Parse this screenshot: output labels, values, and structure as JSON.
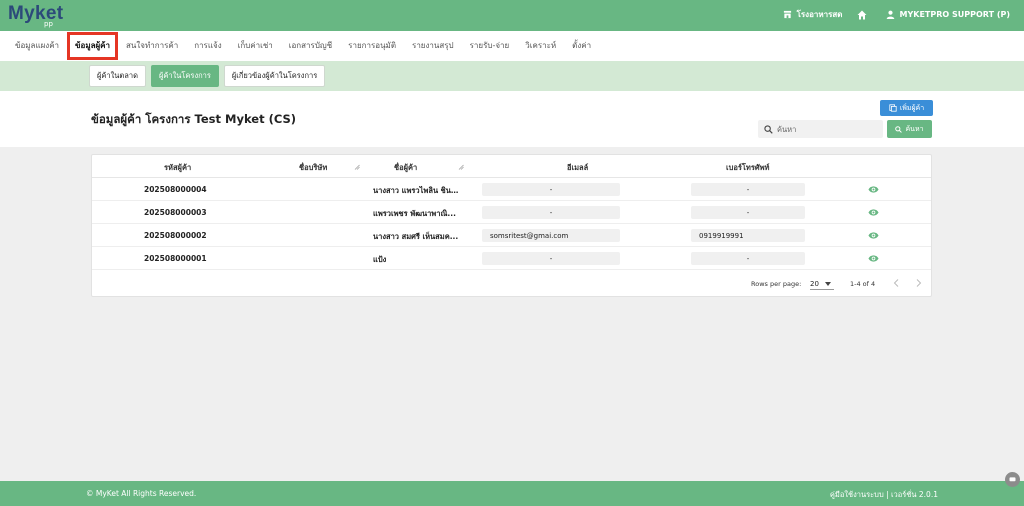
{
  "app": {
    "logo": "Myket",
    "logo_sub": "pp",
    "canteen_label": "โรงอาหารสด",
    "user_label": "MYKETPRO SUPPORT (P)"
  },
  "menu": {
    "items": [
      {
        "label": "ข้อมูลแผงค้า"
      },
      {
        "label": "ข้อมูลผู้ค้า"
      },
      {
        "label": "สนใจทำการค้า"
      },
      {
        "label": "การแจ้ง"
      },
      {
        "label": "เก็บค่าเช่า"
      },
      {
        "label": "เอกสารบัญชี"
      },
      {
        "label": "รายการอนุมัติ"
      },
      {
        "label": "รายงานสรุป"
      },
      {
        "label": "รายรับ-จ่าย"
      },
      {
        "label": "วิเคราะห์"
      },
      {
        "label": "ตั้งค่า"
      }
    ],
    "active_index": 1
  },
  "subtabs": [
    {
      "label": "ผู้ค้าในตลาด"
    },
    {
      "label": "ผู้ค้าในโครงการ"
    },
    {
      "label": "ผู้เกี่ยวข้องผู้ค้าในโครงการ"
    }
  ],
  "page": {
    "title": "ข้อมูลผู้ค้า โครงการ Test Myket (CS)",
    "add_button": "เพิ่มผู้ค้า",
    "search_placeholder": "ค้นหา",
    "search_button": "ค้นหา"
  },
  "table": {
    "headers": {
      "code": "รหัสผู้ค้า",
      "company": "ชื่อบริษัท",
      "name": "ชื่อผู้ค้า",
      "email": "อีเมลล์",
      "phone": "เบอร์โทรศัพท์"
    },
    "rows": [
      {
        "code": "202508000004",
        "company": "",
        "name": "นางสาว แพรวไพลิน ชิน...",
        "email": "-",
        "phone": "-"
      },
      {
        "code": "202508000003",
        "company": "",
        "name": "แพรวเพชร พัฒนาพาณิ...",
        "email": "-",
        "phone": "-"
      },
      {
        "code": "202508000002",
        "company": "",
        "name": "นางสาว สมศรี เห็นสมค...",
        "email": "somsritest@gmai.com",
        "phone": "0919919991"
      },
      {
        "code": "202508000001",
        "company": "",
        "name": "แป้ง",
        "email": "-",
        "phone": "-"
      }
    ]
  },
  "pagination": {
    "rows_per_page_label": "Rows per page:",
    "rows_per_page": "20",
    "range": "1-4 of 4"
  },
  "footer": {
    "copyright": "© MyKet All Rights Reserved.",
    "right_text": "คู่มือใช้งานระบบ | เวอร์ชั่น 2.0.1"
  },
  "colors": {
    "primary_green": "#68b783",
    "light_green": "#d3e9d4",
    "blue": "#3a8ed8",
    "highlight_red": "#e53524"
  }
}
